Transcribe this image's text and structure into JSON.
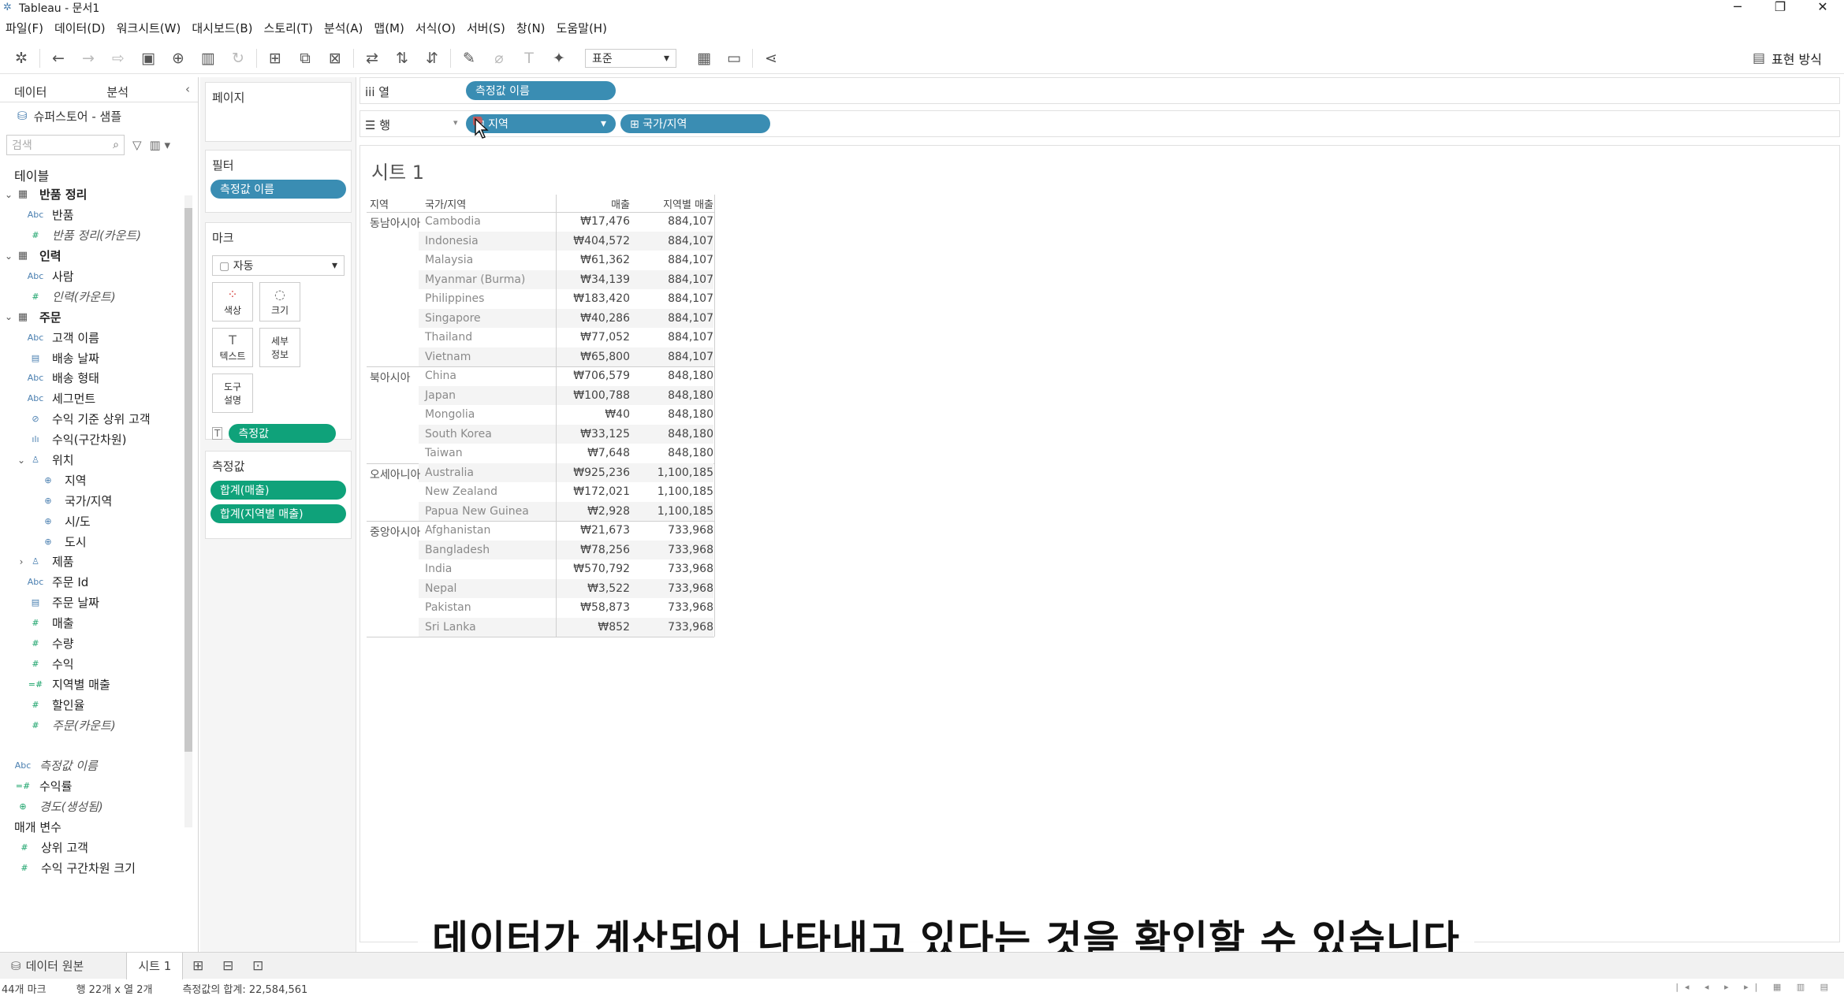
{
  "window": {
    "title": "Tableau - 문서1",
    "controls": [
      "─",
      "❐",
      "✕"
    ]
  },
  "menu": [
    "파일(F)",
    "데이터(D)",
    "워크시트(W)",
    "대시보드(B)",
    "스토리(T)",
    "분석(A)",
    "맵(M)",
    "서식(O)",
    "서버(S)",
    "창(N)",
    "도움말(H)"
  ],
  "toolbar": {
    "fit_select": "표준",
    "show_me": "표현 방식"
  },
  "data_pane": {
    "tabs": [
      "데이터",
      "분석"
    ],
    "datasource": "슈퍼스토어 - 샘플",
    "search_placeholder": "검색",
    "tables_header": "테이블",
    "tree": [
      {
        "arrow": "⌄",
        "icon": "▦",
        "type": "grid",
        "label": "반품 정리",
        "bold": true,
        "indent": 0
      },
      {
        "arrow": "",
        "icon": "Abc",
        "type": "blue",
        "label": "반품",
        "indent": 1
      },
      {
        "arrow": "",
        "icon": "#",
        "type": "green",
        "label": "반품 정리(카운트)",
        "italic": true,
        "indent": 1
      },
      {
        "arrow": "⌄",
        "icon": "▦",
        "type": "grid",
        "label": "인력",
        "bold": true,
        "indent": 0
      },
      {
        "arrow": "",
        "icon": "Abc",
        "type": "blue",
        "label": "사람",
        "indent": 1
      },
      {
        "arrow": "",
        "icon": "#",
        "type": "green",
        "label": "인력(카운트)",
        "italic": true,
        "indent": 1
      },
      {
        "arrow": "⌄",
        "icon": "▦",
        "type": "grid",
        "label": "주문",
        "bold": true,
        "indent": 0
      },
      {
        "arrow": "",
        "icon": "Abc",
        "type": "blue",
        "label": "고객 이름",
        "indent": 1
      },
      {
        "arrow": "",
        "icon": "▤",
        "type": "blue",
        "label": "배송 날짜",
        "indent": 1
      },
      {
        "arrow": "",
        "icon": "Abc",
        "type": "blue",
        "label": "배송 형태",
        "indent": 1
      },
      {
        "arrow": "",
        "icon": "Abc",
        "type": "blue",
        "label": "세그먼트",
        "indent": 1
      },
      {
        "arrow": "",
        "icon": "⊘",
        "type": "blue",
        "label": "수익 기준 상위 고객",
        "indent": 1
      },
      {
        "arrow": "",
        "icon": "ılı",
        "type": "blue",
        "label": "수익(구간차원)",
        "indent": 1
      },
      {
        "arrow": "⌄",
        "icon": "♙",
        "type": "blue",
        "label": "위치",
        "indent": 1
      },
      {
        "arrow": "",
        "icon": "⊕",
        "type": "blue",
        "label": "지역",
        "indent": 2
      },
      {
        "arrow": "",
        "icon": "⊕",
        "type": "blue",
        "label": "국가/지역",
        "indent": 2
      },
      {
        "arrow": "",
        "icon": "⊕",
        "type": "blue",
        "label": "시/도",
        "indent": 2
      },
      {
        "arrow": "",
        "icon": "⊕",
        "type": "blue",
        "label": "도시",
        "indent": 2
      },
      {
        "arrow": "›",
        "icon": "♙",
        "type": "blue",
        "label": "제품",
        "indent": 1
      },
      {
        "arrow": "",
        "icon": "Abc",
        "type": "blue",
        "label": "주문 Id",
        "indent": 1
      },
      {
        "arrow": "",
        "icon": "▤",
        "type": "blue",
        "label": "주문 날짜",
        "indent": 1
      },
      {
        "arrow": "",
        "icon": "#",
        "type": "green",
        "label": "매출",
        "indent": 1
      },
      {
        "arrow": "",
        "icon": "#",
        "type": "green",
        "label": "수량",
        "indent": 1
      },
      {
        "arrow": "",
        "icon": "#",
        "type": "green",
        "label": "수익",
        "indent": 1
      },
      {
        "arrow": "",
        "icon": "=#",
        "type": "green",
        "label": "지역별 매출",
        "indent": 1
      },
      {
        "arrow": "",
        "icon": "#",
        "type": "green",
        "label": "할인율",
        "indent": 1
      },
      {
        "arrow": "",
        "icon": "#",
        "type": "green",
        "label": "주문(카운트)",
        "italic": true,
        "indent": 1
      },
      {
        "arrow": "",
        "icon": "",
        "type": "blue",
        "label": "",
        "indent": 0
      },
      {
        "arrow": "",
        "icon": "Abc",
        "type": "blue",
        "label": "측정값 이름",
        "italic": true,
        "indent": 0
      },
      {
        "arrow": "",
        "icon": "=#",
        "type": "green",
        "label": "수익률",
        "indent": 0
      },
      {
        "arrow": "",
        "icon": "⊕",
        "type": "green",
        "label": "경도(생성됨)",
        "italic": true,
        "indent": 0
      }
    ],
    "params_header": "매개 변수",
    "params": [
      {
        "icon": "#",
        "label": "상위 고객"
      },
      {
        "icon": "#",
        "label": "수익 구간차원 크기"
      }
    ]
  },
  "shelves": {
    "pages": "페이지",
    "filters": "필터",
    "filter_pill": "측정값 이름",
    "marks": "마크",
    "marks_type": "자동",
    "mark_buttons": [
      {
        "icon": "⁘",
        "label": "색상"
      },
      {
        "icon": "◌",
        "label": "크기"
      },
      {
        "icon": "T",
        "label": "텍스트"
      },
      {
        "icon": "",
        "label": "세부\n정보"
      },
      {
        "icon": "",
        "label": "도구\n설명"
      }
    ],
    "marks_pill": "측정값",
    "measure_values": "측정값",
    "measure_pills": [
      "합계(매출)",
      "합계(지역별 매출)"
    ],
    "columns_label": "iii 열",
    "columns_pill": "측정값 이름",
    "rows_label": "☰ 행",
    "rows_pills": [
      "⊞ 지역",
      "⊞ 국가/지역"
    ]
  },
  "view": {
    "sheet_title": "시트 1",
    "headers": [
      "지역",
      "국가/지역",
      "매출",
      "지역별 매출"
    ],
    "groups": [
      {
        "region": "동남아시아",
        "rows": [
          [
            "Cambodia",
            "₩17,476",
            "884,107"
          ],
          [
            "Indonesia",
            "₩404,572",
            "884,107"
          ],
          [
            "Malaysia",
            "₩61,362",
            "884,107"
          ],
          [
            "Myanmar (Burma)",
            "₩34,139",
            "884,107"
          ],
          [
            "Philippines",
            "₩183,420",
            "884,107"
          ],
          [
            "Singapore",
            "₩40,286",
            "884,107"
          ],
          [
            "Thailand",
            "₩77,052",
            "884,107"
          ],
          [
            "Vietnam",
            "₩65,800",
            "884,107"
          ]
        ]
      },
      {
        "region": "북아시아",
        "rows": [
          [
            "China",
            "₩706,579",
            "848,180"
          ],
          [
            "Japan",
            "₩100,788",
            "848,180"
          ],
          [
            "Mongolia",
            "₩40",
            "848,180"
          ],
          [
            "South Korea",
            "₩33,125",
            "848,180"
          ],
          [
            "Taiwan",
            "₩7,648",
            "848,180"
          ]
        ]
      },
      {
        "region": "오세아니아",
        "rows": [
          [
            "Australia",
            "₩925,236",
            "1,100,185"
          ],
          [
            "New Zealand",
            "₩172,021",
            "1,100,185"
          ],
          [
            "Papua New Guinea",
            "₩2,928",
            "1,100,185"
          ]
        ]
      },
      {
        "region": "중앙아시아",
        "rows": [
          [
            "Afghanistan",
            "₩21,673",
            "733,968"
          ],
          [
            "Bangladesh",
            "₩78,256",
            "733,968"
          ],
          [
            "India",
            "₩570,792",
            "733,968"
          ],
          [
            "Nepal",
            "₩3,522",
            "733,968"
          ],
          [
            "Pakistan",
            "₩58,873",
            "733,968"
          ],
          [
            "Sri Lanka",
            "₩852",
            "733,968"
          ]
        ]
      }
    ]
  },
  "sheet_tabs": {
    "datasource_tab": "데이터 원본",
    "active_tab": "시트 1"
  },
  "status": {
    "marks": "44개 마크",
    "rows_cols": "행 22개 x 열 2개",
    "sum": "측정값의 합계: 22,584,561"
  },
  "caption": "데이터가 계산되어 나타내고 있다는 것을 확인할 수 있습니다",
  "colors": {
    "dimension_pill": "#3a8db3",
    "measure_pill": "#0fa27a"
  }
}
